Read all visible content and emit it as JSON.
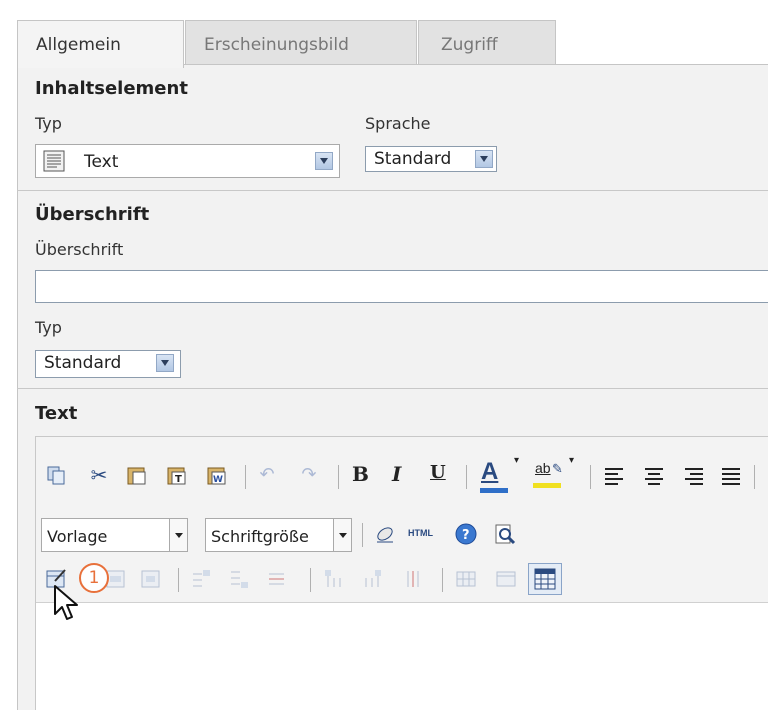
{
  "tabs": [
    {
      "label": "Allgemein",
      "active": true
    },
    {
      "label": "Erscheinungsbild",
      "active": false
    },
    {
      "label": "Zugriff",
      "active": false
    }
  ],
  "content_element": {
    "heading": "Inhaltselement",
    "type_label": "Typ",
    "type_value": "Text",
    "language_label": "Sprache",
    "language_value": "Standard"
  },
  "header_section": {
    "heading": "Überschrift",
    "field_label": "Überschrift",
    "field_value": "",
    "type_label": "Typ",
    "type_value": "Standard"
  },
  "text_section": {
    "heading": "Text",
    "style_dropdown": "Vorlage",
    "fontsize_dropdown": "Schriftgröße",
    "html_button": "HTML",
    "bold": "B",
    "italic": "I",
    "underline": "U",
    "font_color_glyph": "A",
    "highlight_glyph": "ab"
  },
  "annotation": {
    "marker": "1",
    "color": "#e8703a"
  },
  "colors": {
    "panel_bg": "#f2f2f2",
    "tab_inactive": "#e2e2e2",
    "border": "#c5c5c5",
    "accent": "#2f6fc8"
  }
}
